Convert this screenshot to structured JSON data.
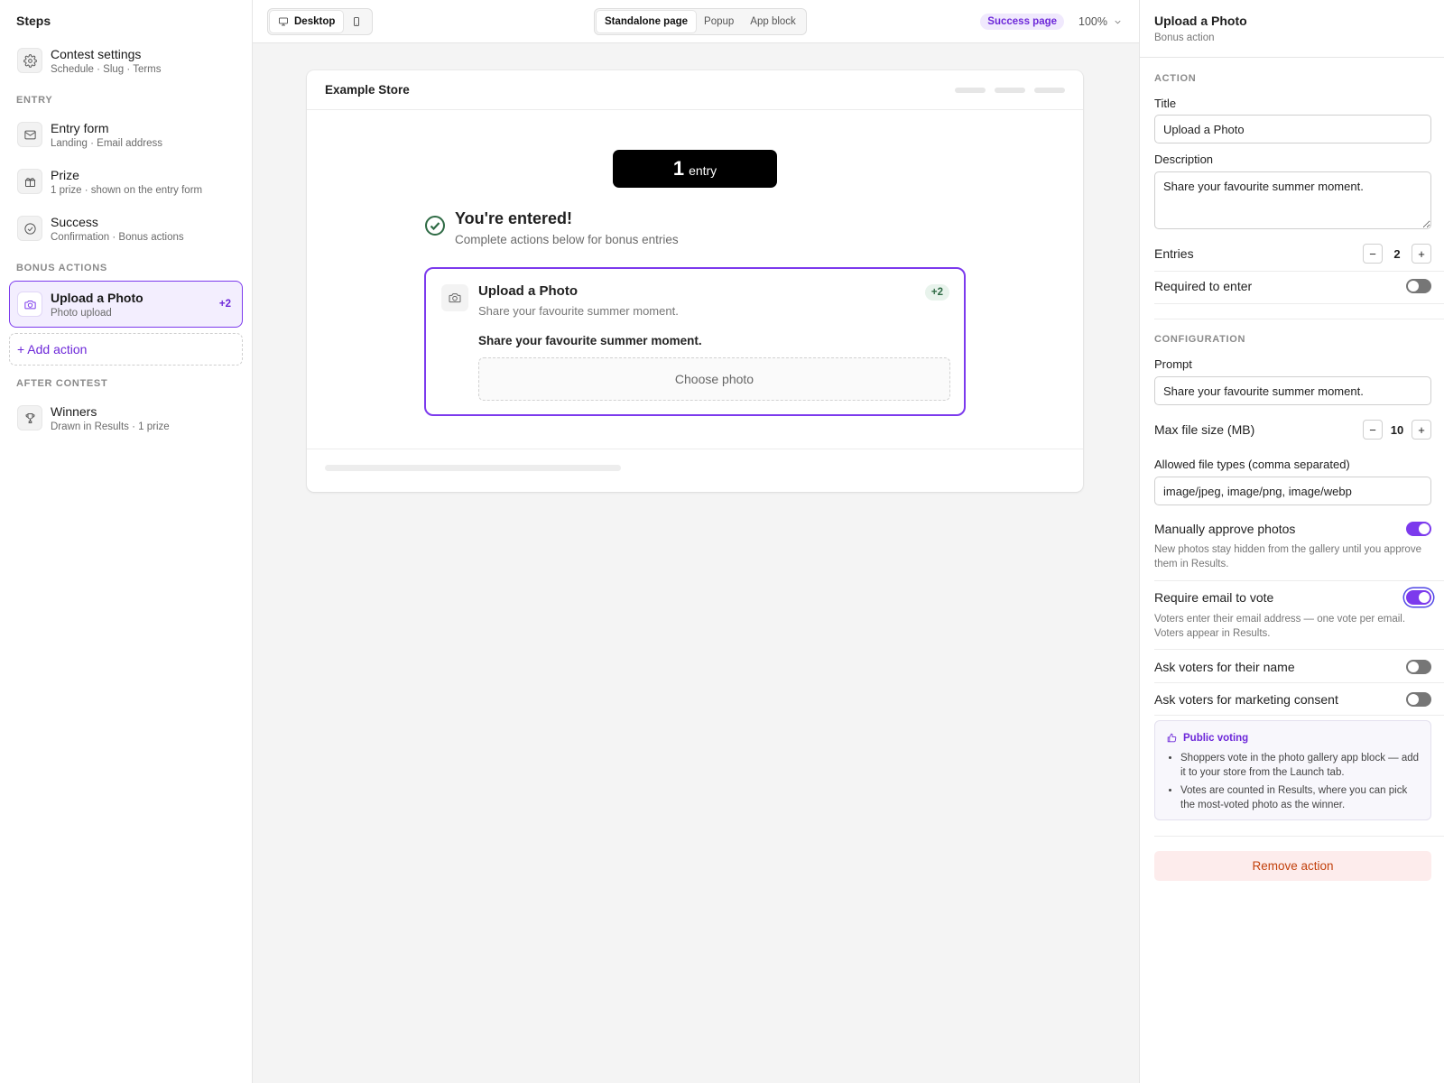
{
  "sidebar": {
    "title": "Steps",
    "steps_main": [
      {
        "name": "Contest settings",
        "sub": "Schedule · Slug · Terms",
        "icon": "gear-icon"
      }
    ],
    "entry_label": "ENTRY",
    "entry_steps": [
      {
        "name": "Entry form",
        "sub": "Landing · Email address",
        "icon": "mail-icon"
      },
      {
        "name": "Prize",
        "sub": "1 prize · shown on the entry form",
        "icon": "gift-icon"
      },
      {
        "name": "Success",
        "sub": "Confirmation · Bonus actions",
        "icon": "check-circle-icon"
      }
    ],
    "bonus_label": "BONUS ACTIONS",
    "bonus_steps": [
      {
        "name": "Upload a Photo",
        "sub": "Photo upload",
        "badge": "+2",
        "icon": "camera-icon"
      }
    ],
    "add_action": "+ Add action",
    "after_label": "AFTER CONTEST",
    "after_steps": [
      {
        "name": "Winners",
        "sub": "Drawn in Results · 1 prize",
        "icon": "trophy-icon"
      }
    ]
  },
  "toolbar": {
    "device": [
      {
        "label": "Desktop",
        "icon": "monitor-icon",
        "active": true
      },
      {
        "label": "",
        "icon": "phone-icon",
        "active": false
      }
    ],
    "views": [
      {
        "label": "Standalone page",
        "active": true
      },
      {
        "label": "Popup",
        "active": false
      },
      {
        "label": "App block",
        "active": false
      }
    ],
    "page_pill": "Success page",
    "zoom": "100%"
  },
  "preview": {
    "store_name": "Example Store",
    "entry_count": "1",
    "entry_unit": "entry",
    "entered_title": "You're entered!",
    "entered_sub": "Complete actions below for bonus entries",
    "action": {
      "title": "Upload a Photo",
      "description": "Share your favourite summer moment.",
      "badge": "+2",
      "prompt": "Share your favourite summer moment.",
      "choose": "Choose photo"
    }
  },
  "panel": {
    "title": "Upload a Photo",
    "subtitle": "Bonus action",
    "action_section": "ACTION",
    "title_label": "Title",
    "title_value": "Upload a Photo",
    "description_label": "Description",
    "description_value": "Share your favourite summer moment.",
    "entries_label": "Entries",
    "entries_value": "2",
    "required_label": "Required to enter",
    "required_on": false,
    "config_section": "CONFIGURATION",
    "prompt_label": "Prompt",
    "prompt_value": "Share your favourite summer moment.",
    "max_size_label": "Max file size (MB)",
    "max_size_value": "10",
    "types_label": "Allowed file types (comma separated)",
    "types_value": "image/jpeg, image/png, image/webp",
    "approve_label": "Manually approve photos",
    "approve_on": true,
    "approve_help": "New photos stay hidden from the gallery until you approve them in Results.",
    "email_vote_label": "Require email to vote",
    "email_vote_on": true,
    "email_vote_help": "Voters enter their email address — one vote per email. Voters appear in Results.",
    "ask_name_label": "Ask voters for their name",
    "ask_name_on": false,
    "ask_consent_label": "Ask voters for marketing consent",
    "ask_consent_on": false,
    "info": {
      "title": "Public voting",
      "icon": "thumbs-up-icon",
      "items": [
        "Shoppers vote in the photo gallery app block — add it to your store from the Launch tab.",
        "Votes are counted in Results, where you can pick the most-voted photo as the winner."
      ]
    },
    "remove": "Remove action",
    "minus": "−",
    "plus": "+"
  },
  "colors": {
    "accent": "#7c3aed",
    "accent_soft": "#f3eefe",
    "success": "#2f6b45",
    "danger": "#c2410c"
  }
}
